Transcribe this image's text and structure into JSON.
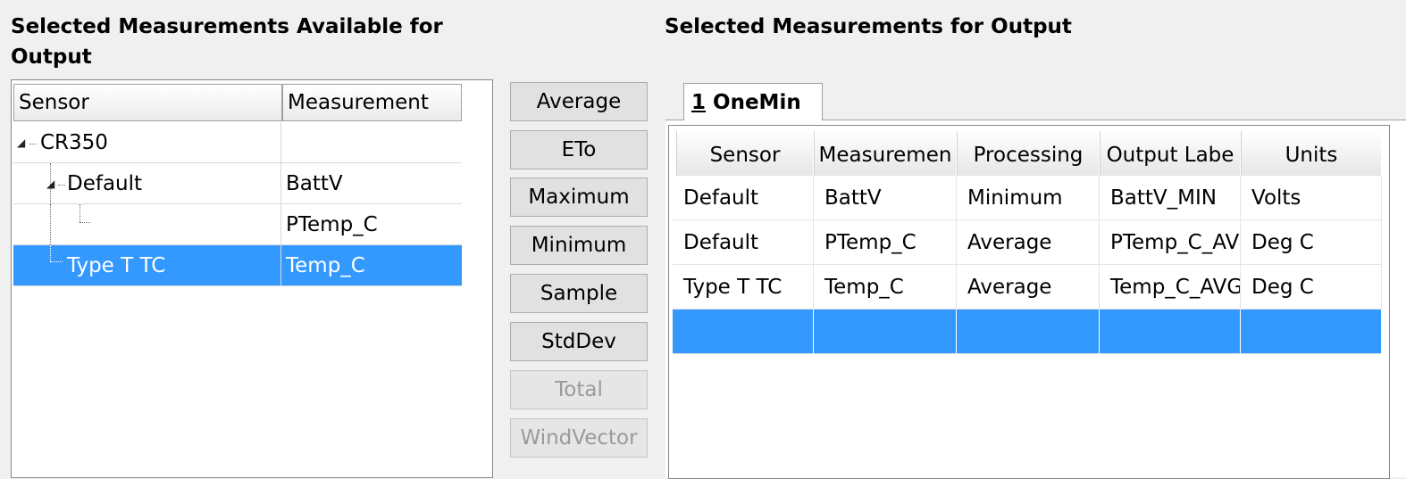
{
  "left_heading": {
    "line1": "Selected Measurements Available for",
    "line2": "Output"
  },
  "right_heading": "Selected Measurements for Output",
  "tree": {
    "headers": [
      "Sensor",
      "Measurement"
    ],
    "rows": [
      {
        "sensor": "CR350",
        "measurement": ""
      },
      {
        "sensor": "Default",
        "measurement": "BattV"
      },
      {
        "sensor": "",
        "measurement": "PTemp_C"
      },
      {
        "sensor": "Type T TC",
        "measurement": "Temp_C"
      }
    ]
  },
  "buttons": [
    {
      "label": "Average",
      "enabled": true
    },
    {
      "label": "ETo",
      "enabled": true
    },
    {
      "label": "Maximum",
      "enabled": true
    },
    {
      "label": "Minimum",
      "enabled": true
    },
    {
      "label": "Sample",
      "enabled": true
    },
    {
      "label": "StdDev",
      "enabled": true
    },
    {
      "label": "Total",
      "enabled": false
    },
    {
      "label": "WindVector",
      "enabled": false
    }
  ],
  "tab": {
    "number": "1",
    "name": "OneMin"
  },
  "grid": {
    "headers": [
      "Sensor",
      "Measuremen",
      "Processing",
      "Output Labe",
      "Units"
    ],
    "rows": [
      [
        "Default",
        "BattV",
        "Minimum",
        "BattV_MIN",
        "Volts"
      ],
      [
        "Default",
        "PTemp_C",
        "Average",
        "PTemp_C_AV",
        "Deg C"
      ],
      [
        "Type T TC",
        "Temp_C",
        "Average",
        "Temp_C_AVG",
        "Deg C"
      ],
      [
        "",
        "",
        "",
        "",
        ""
      ]
    ]
  },
  "colors": {
    "selection": "#3399ff",
    "background": "#f0f0f0"
  }
}
